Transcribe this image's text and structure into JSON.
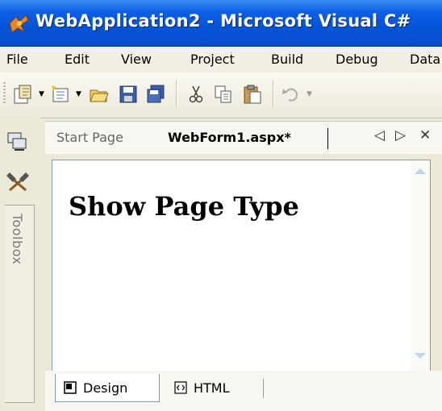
{
  "window": {
    "title": "WebApplication2 - Microsoft Visual C#"
  },
  "menu": {
    "items": [
      "File",
      "Edit",
      "View",
      "Project",
      "Build",
      "Debug",
      "Data"
    ]
  },
  "toolbar": {
    "buttons": [
      "new-project-icon",
      "add-new-item-icon",
      "open-file-icon",
      "save-icon",
      "save-all-icon",
      "cut-icon",
      "copy-icon",
      "paste-icon",
      "undo-icon"
    ]
  },
  "dock": {
    "toolbox_label": "Toolbox"
  },
  "tabs": {
    "start_page": "Start Page",
    "active": "WebForm1.aspx*",
    "nav_left": "◁",
    "nav_right": "▷",
    "close": "✕"
  },
  "document": {
    "heading": "Show Page Type"
  },
  "view_tabs": {
    "design": "Design",
    "html": "HTML"
  }
}
